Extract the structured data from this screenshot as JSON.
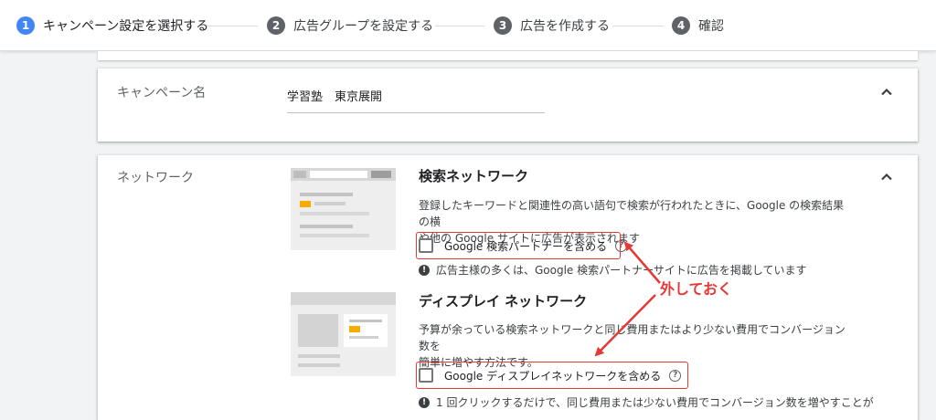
{
  "stepper": {
    "steps": [
      {
        "number": "1",
        "label": "キャンペーン設定を選択する",
        "state": "active"
      },
      {
        "number": "2",
        "label": "広告グループを設定する",
        "state": "inactive"
      },
      {
        "number": "3",
        "label": "広告を作成する",
        "state": "inactive"
      },
      {
        "number": "4",
        "label": "確認",
        "state": "inactive"
      }
    ]
  },
  "campaign_name": {
    "title": "キャンペーン名",
    "value": "学習塾　東京展開",
    "collapse_icon": "chevron-up-icon"
  },
  "network": {
    "title": "ネットワーク",
    "collapse_icon": "chevron-up-icon",
    "search": {
      "title": "検索ネットワーク",
      "description_line1": "登録したキーワードと関連性の高い語句で検索が行われたときに、Google の検索結果の横",
      "description_line2": "や他の Google サイトに広告が表示されます",
      "checkbox_label": "Google 検索パートナーを含める",
      "checked": false,
      "help_icon": "help-circle-icon",
      "info_text": "広告主様の多くは、Google 検索パートナーサイトに広告を掲載しています"
    },
    "display": {
      "title": "ディスプレイ ネットワーク",
      "description_line1": "予算が余っている検索ネットワークと同じ費用またはより少ない費用でコンバージョン数を",
      "description_line2": "簡単に増やす方法です。",
      "checkbox_label": "Google ディスプレイネットワークを含める",
      "checked": false,
      "help_icon": "help-circle-icon",
      "info_text": "1 回クリックするだけで、同じ費用または少ない費用でコンバージョン数を増やすことが"
    }
  },
  "annotation": {
    "text": "外しておく",
    "color": "#e53935"
  },
  "colors": {
    "accent": "#4285f4",
    "step_inactive": "#5f6368",
    "illustration_highlight": "#f9ab00"
  }
}
